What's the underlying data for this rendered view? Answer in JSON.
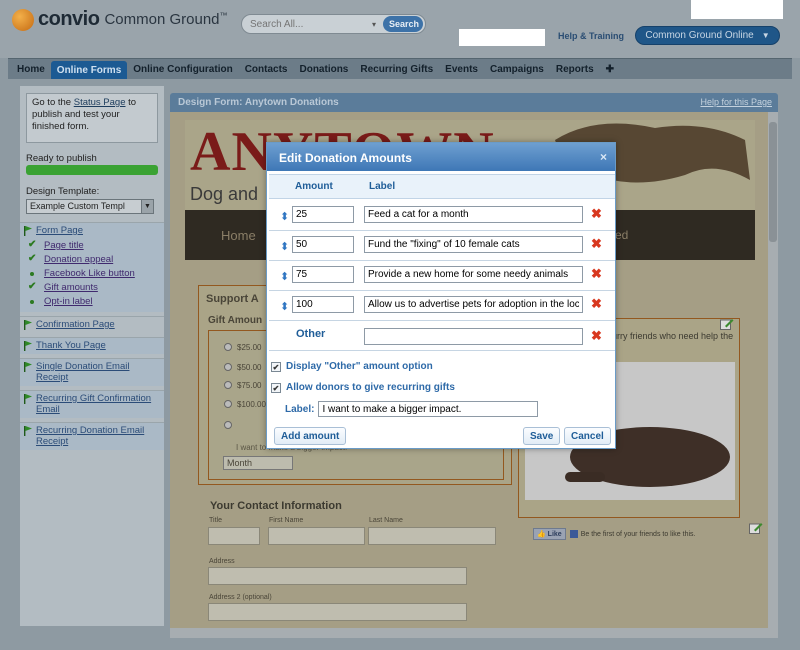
{
  "header": {
    "brand": "convio",
    "product": "Common Ground",
    "trademark": "™",
    "search_placeholder": "Search All...",
    "search_button": "Search",
    "help_link": "Help & Training",
    "app_switcher": "Common Ground Online"
  },
  "nav": {
    "items": [
      "Home",
      "Online Forms",
      "Online Configuration",
      "Contacts",
      "Donations",
      "Recurring Gifts",
      "Events",
      "Campaigns",
      "Reports",
      "✚"
    ],
    "active_index": 1
  },
  "sidebar": {
    "notice_pre": "Go to the ",
    "notice_link": "Status Page",
    "notice_post": " to publish and test your finished form.",
    "ready_label": "Ready to publish",
    "progress_percent": 100,
    "design_template_label": "Design Template:",
    "design_template_value": "Example Custom Templ",
    "tree": {
      "form_page": "Form Page",
      "sub_items": [
        "Page title",
        "Donation appeal",
        "Facebook Like button",
        "Gift amounts",
        "Opt-in label"
      ],
      "sections": [
        "Confirmation Page",
        "Thank You Page",
        "Single Donation Email Receipt",
        "Recurring Gift Confirmation Email",
        "Recurring Donation Email Receipt"
      ]
    }
  },
  "design": {
    "title": "Design Form: Anytown Donations",
    "help_link": "Help for this Page",
    "banner_title": "ANYTOWN",
    "banner_subtitle": "Dog and",
    "nav_home": "Home",
    "nav_right": "ed",
    "support_title": "Support A",
    "gift_title": "Gift Amoun",
    "gift_amounts": [
      "$25.00",
      "$50.00",
      "$75.00",
      "$100.00"
    ],
    "recurring_text": "I want to make a bigger impact.",
    "frequency": "Month",
    "contact_title": "Your Contact Information",
    "fields": {
      "title": "Title",
      "first": "First Name",
      "last": "Last Name",
      "address": "Address",
      "address2": "Address 2 (optional)"
    },
    "furry_text": "urry friends who need help the",
    "fb_like": "Like",
    "fb_text": "Be the first of your friends to like this."
  },
  "modal": {
    "title": "Edit Donation Amounts",
    "close": "×",
    "col_amount": "Amount",
    "col_label": "Label",
    "rows": [
      {
        "amount": "25",
        "label": "Feed a cat for a month"
      },
      {
        "amount": "50",
        "label": "Fund the \"fixing\" of 10 female cats"
      },
      {
        "amount": "75",
        "label": "Provide a new home for some needy animals"
      },
      {
        "amount": "100",
        "label": "Allow us to advertise pets for adoption in the local paper"
      }
    ],
    "other_label": "Other",
    "other_value": "",
    "display_other": "Display \"Other\" amount option",
    "display_other_checked": true,
    "allow_recurring": "Allow donors to give recurring gifts",
    "allow_recurring_checked": true,
    "label_caption": "Label:",
    "label_value": "I want to make a bigger impact.",
    "add_button": "Add amount",
    "save_button": "Save",
    "cancel_button": "Cancel"
  },
  "colors": {
    "accent": "#1c5a93",
    "modal_header": "#3e77b6",
    "delete": "#d8381f",
    "progress": "#3aa233"
  }
}
